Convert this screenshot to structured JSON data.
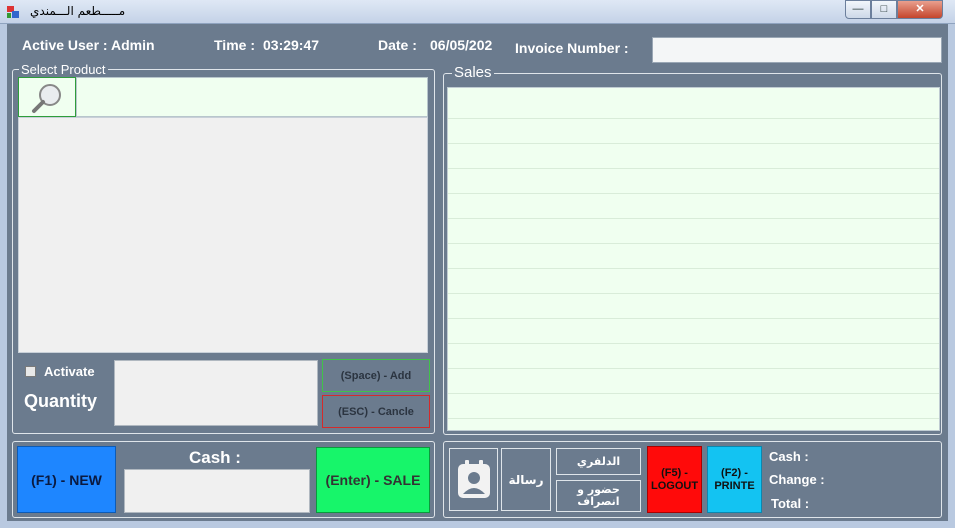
{
  "window": {
    "title": "مـــــطعم الـــمندي",
    "minimize": "0",
    "maximize": "1",
    "close": "r"
  },
  "header": {
    "active_user_label": "Active User : Admin",
    "time_label": "Time :",
    "time_value": "03:29:47",
    "date_label": "Date :",
    "date_value": "06/05/202",
    "invoice_label": "Invoice Number :",
    "invoice_value": ""
  },
  "select_product": {
    "group_title": "Select Product",
    "search_value": "",
    "activate_label": "Activate",
    "activate_checked": false,
    "quantity_label": "Quantity",
    "quantity_value": "",
    "add_button": "(Space) - Add",
    "cancel_button": "(ESC) - Cancle"
  },
  "sales": {
    "group_title": "Sales"
  },
  "bottom_left": {
    "new_button": "(F1) - NEW",
    "cash_label": "Cash :",
    "cash_value": "",
    "sale_button": "(Enter) - SALE"
  },
  "bottom_right": {
    "contact_icon": "contact-card-icon",
    "message_button": "رسالة",
    "delivery_button": "الدلفري",
    "attendance_button": "حضور و انصراف",
    "logout_button": "(F5) - LOGOUT",
    "print_button": "(F2) - PRINTE",
    "cash_label": "Cash :",
    "change_label": "Change :",
    "total_label": "Total :"
  },
  "colors": {
    "background": "#6b7b8e",
    "new": "#1e86ff",
    "sale": "#17f56a",
    "logout": "#ff0a0a",
    "print": "#13c3f2"
  }
}
